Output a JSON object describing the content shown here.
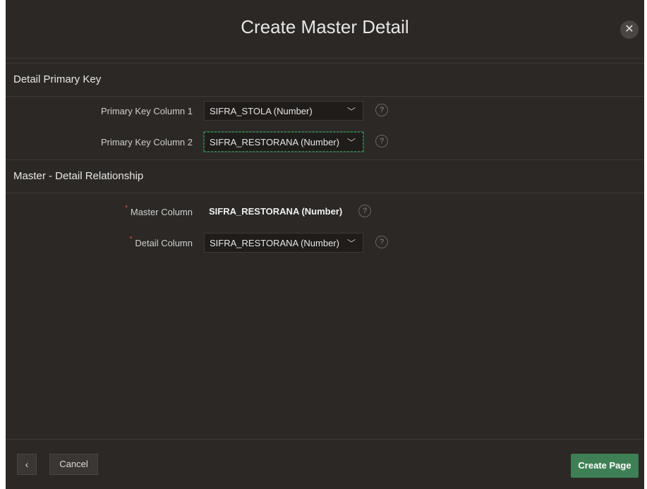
{
  "dialog": {
    "title": "Create Master Detail",
    "close_icon": "close-icon"
  },
  "sections": {
    "primary_key": {
      "header": "Detail Primary Key",
      "pk1": {
        "label": "Primary Key Column 1",
        "value": "SIFRA_STOLA (Number)"
      },
      "pk2": {
        "label": "Primary Key Column 2",
        "value": "SIFRA_RESTORANA (Number)"
      }
    },
    "relationship": {
      "header": "Master - Detail Relationship",
      "master": {
        "label": "Master Column",
        "value": "SIFRA_RESTORANA (Number)"
      },
      "detail": {
        "label": "Detail Column",
        "value": "SIFRA_RESTORANA (Number)"
      }
    }
  },
  "icons": {
    "chevron": "chevron-down-icon",
    "help": "help-icon",
    "back": "chevron-left-icon"
  },
  "footer": {
    "cancel_label": "Cancel",
    "create_label": "Create Page"
  },
  "colors": {
    "background": "#2b2825",
    "primary_button": "#3f7f55",
    "required_marker": "#d64848"
  }
}
